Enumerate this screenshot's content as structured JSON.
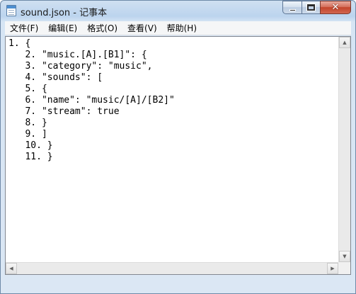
{
  "window": {
    "title": "sound.json - 记事本",
    "app_icon": "notepad-icon",
    "caption": {
      "minimize_icon": "minimize-icon",
      "maximize_icon": "maximize-icon",
      "close_icon": "close-icon",
      "close_glyph": "✕"
    }
  },
  "menu": {
    "items": [
      "文件(F)",
      "编辑(E)",
      "格式(O)",
      "查看(V)",
      "帮助(H)"
    ]
  },
  "editor": {
    "content": "1. {\n   2. \"music.[A].[B1]\": {\n   3. \"category\": \"music\",\n   4. \"sounds\": [\n   5. {\n   6. \"name\": \"music/[A]/[B2]\"\n   7. \"stream\": true\n   8. }\n   9. ]\n   10. }\n   11. }"
  },
  "scrollbars": {
    "up_glyph": "▲",
    "down_glyph": "▼",
    "left_glyph": "◀",
    "right_glyph": "▶"
  }
}
